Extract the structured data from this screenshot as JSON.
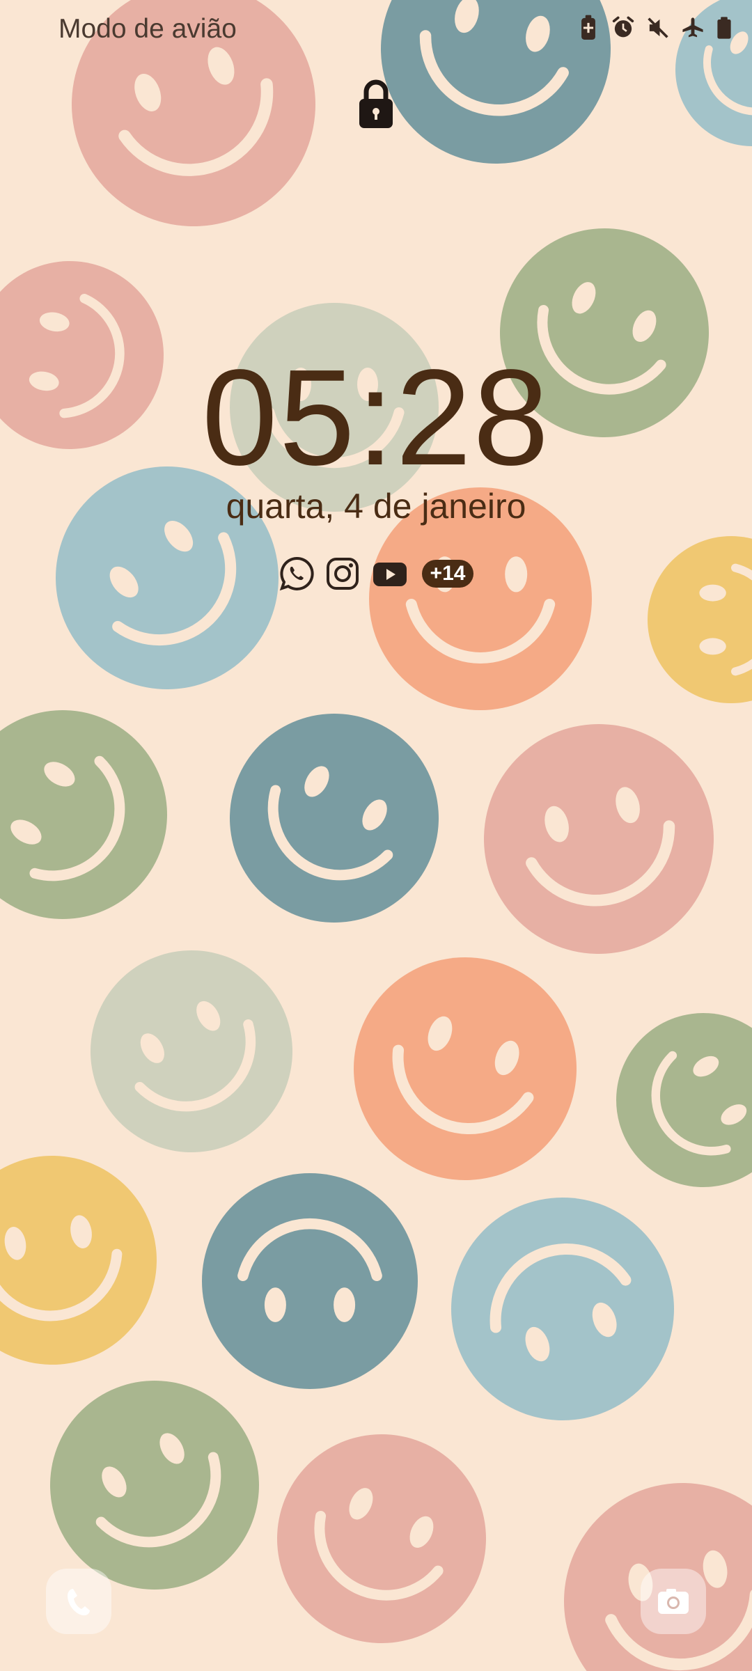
{
  "status_bar": {
    "mode_text": "Modo de avião",
    "icons": [
      "battery-saver-icon",
      "alarm-icon",
      "mute-icon",
      "airplane-icon",
      "battery-icon"
    ]
  },
  "lock_screen": {
    "lock_icon": "lock-icon",
    "time": "05:28",
    "date": "quarta, 4 de janeiro",
    "notification_icons": [
      "whatsapp-icon",
      "instagram-icon",
      "youtube-icon"
    ],
    "more_notifications": "+14"
  },
  "shortcuts": {
    "left": "phone-icon",
    "right": "camera-icon"
  },
  "colors": {
    "background": "#fae6d3",
    "text_dark": "#4a2c14",
    "smiley_teal": "#7a9ca2",
    "smiley_pink": "#e7b0a4",
    "smiley_green": "#a9b68f",
    "smiley_sage": "#cfd1bd",
    "smiley_peach": "#f5aa86",
    "smiley_blue": "#a3c3c9",
    "smiley_yellow": "#f0c872",
    "face_line": "#fae6d3"
  }
}
